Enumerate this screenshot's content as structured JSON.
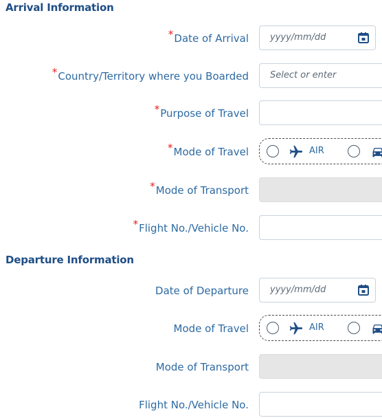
{
  "arrival": {
    "title": "Arrival Information",
    "date_label": "Date of Arrival",
    "date_placeholder": "yyyy/mm/dd",
    "country_label": "Country/Territory where you Boarded",
    "country_placeholder": "Select or enter",
    "purpose_label": "Purpose of Travel",
    "mode_travel_label": "Mode of Travel",
    "mode_transport_label": "Mode of Transport",
    "flight_label": "Flight No./Vehicle No."
  },
  "departure": {
    "title": "Departure Information",
    "date_label": "Date of Departure",
    "date_placeholder": "yyyy/mm/dd",
    "mode_travel_label": "Mode of Travel",
    "mode_transport_label": "Mode of Transport",
    "flight_label": "Flight No./Vehicle No."
  },
  "travel_options": {
    "air_label": "AIR"
  },
  "required_marker": "*",
  "colors": {
    "label": "#2d6aa3",
    "section_title": "#1f4e86",
    "required": "#e02020",
    "disabled_field": "#e6e6e6",
    "icon": "#1f4e86"
  }
}
